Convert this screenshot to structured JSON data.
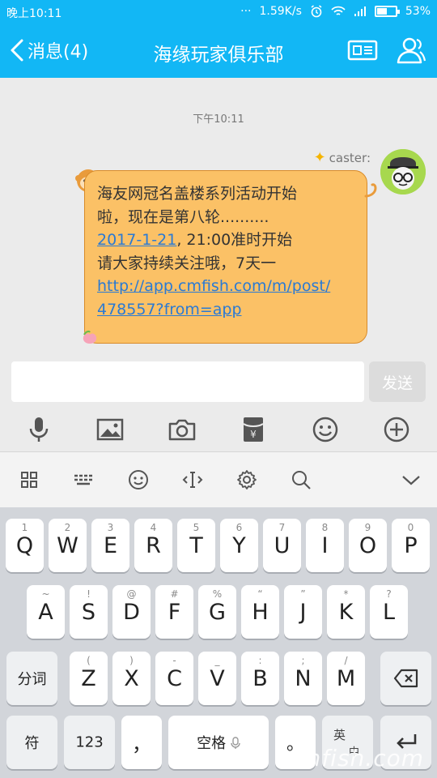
{
  "status_bar": {
    "time": "晚上10:11",
    "dots": "···",
    "speed": "1.59K/s",
    "battery_percent": "53%",
    "battery_level": 0.53
  },
  "header": {
    "back_label": "消息(4)",
    "title": "海缘玩家俱乐部",
    "icons": [
      "profile-card-icon",
      "group-members-icon"
    ]
  },
  "chat": {
    "timestamp": "下午10:11",
    "sender_name": "caster:",
    "message": {
      "line1": "海友网冠名盖楼系列活动开始",
      "line2": "啦，现在是第八轮..........",
      "date_link": "2017-1-21",
      "line3_rest": ", 21:00准时开始",
      "line4": "请大家持续关注哦，7天一",
      "url_line1": "http://app.cmfish.com/m/post/",
      "url_line2": "478557?from=app"
    }
  },
  "composer": {
    "input_value": "",
    "send_label": "发送"
  },
  "toolbar": {
    "icons": [
      "microphone-icon",
      "image-icon",
      "camera-icon",
      "red-packet-icon",
      "emoji-icon",
      "plus-icon"
    ]
  },
  "keyboard_tools": {
    "icons": [
      "grid-icon",
      "keyboard-icon",
      "smiley-icon",
      "cursor-icon",
      "settings-icon",
      "search-icon",
      "collapse-icon"
    ]
  },
  "keyboard": {
    "row1": [
      {
        "num": "1",
        "key": "Q"
      },
      {
        "num": "2",
        "key": "W"
      },
      {
        "num": "3",
        "key": "E"
      },
      {
        "num": "4",
        "key": "R"
      },
      {
        "num": "5",
        "key": "T"
      },
      {
        "num": "6",
        "key": "Y"
      },
      {
        "num": "7",
        "key": "U"
      },
      {
        "num": "8",
        "key": "I"
      },
      {
        "num": "9",
        "key": "O"
      },
      {
        "num": "0",
        "key": "P"
      }
    ],
    "row2": [
      {
        "sym": "~",
        "key": "A"
      },
      {
        "sym": "!",
        "key": "S"
      },
      {
        "sym": "@",
        "key": "D"
      },
      {
        "sym": "#",
        "key": "F"
      },
      {
        "sym": "%",
        "key": "G"
      },
      {
        "sym": "“",
        "key": "H"
      },
      {
        "sym": "”",
        "key": "J"
      },
      {
        "sym": "*",
        "key": "K"
      },
      {
        "sym": "?",
        "key": "L"
      }
    ],
    "row3": [
      {
        "sym": "(",
        "key": "Z"
      },
      {
        "sym": ")",
        "key": "X"
      },
      {
        "sym": "-",
        "key": "C"
      },
      {
        "sym": "_",
        "key": "V"
      },
      {
        "sym": ":",
        "key": "B"
      },
      {
        "sym": ";",
        "key": "N"
      },
      {
        "sym": "/",
        "key": "M"
      }
    ],
    "fenci": "分词",
    "fu": "符",
    "num_123": "123",
    "comma": "，",
    "space": "空格",
    "period": "。",
    "lang_top": "英",
    "lang_bottom": "中"
  },
  "watermark": "cmfish.com",
  "colors": {
    "accent": "#12b7f5",
    "bubble": "#fbc166",
    "link": "#2a7ad4"
  }
}
